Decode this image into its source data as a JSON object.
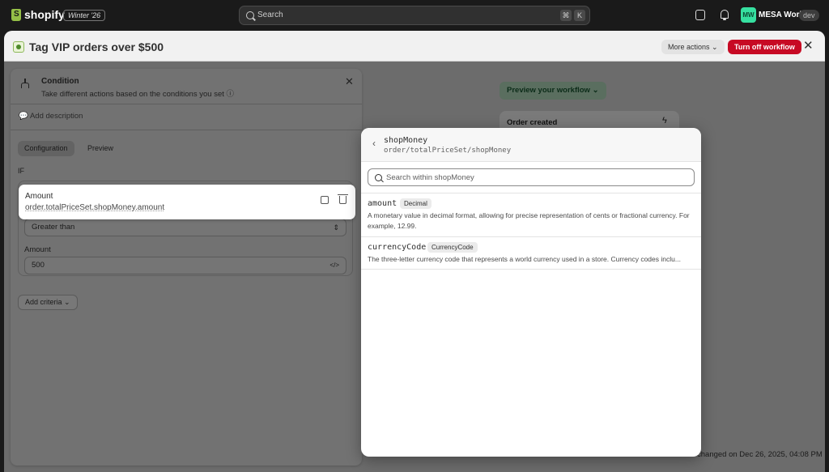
{
  "topbar": {
    "logo_text": "shopify",
    "edition": "Winter '26",
    "search_placeholder": "Search",
    "kbd_cmd": "⌘",
    "kbd_k": "K",
    "avatar_initials": "MW",
    "store_name": "MESA World",
    "env_badge": "dev"
  },
  "window": {
    "title": "Tag VIP orders over $500",
    "more_actions": "More actions",
    "turn_off": "Turn off workflow",
    "close": "✕"
  },
  "condition": {
    "title": "Condition",
    "subtitle": "Take different actions based on the conditions you set ⓘ",
    "add_description": "Add description",
    "tabs": [
      "Configuration",
      "Preview"
    ],
    "if_label": "IF",
    "operator": "Greater than",
    "amount_label": "Amount",
    "amount_value": "500",
    "add_criteria": "Add criteria ⌄"
  },
  "amount_card": {
    "label": "Amount",
    "path": "order.totalPriceSet.shopMoney.amount"
  },
  "canvas": {
    "preview_button": "Preview your workflow ⌄",
    "trigger_title": "Order created",
    "changed_text": "changed on Dec 26, 2025, 04:08 PM"
  },
  "popover": {
    "title": "shopMoney",
    "path": "order/totalPriceSet/shopMoney",
    "search_placeholder": "Search within shopMoney",
    "fields": [
      {
        "name": "amount",
        "type": "Decimal",
        "description": "A monetary value in decimal format, allowing for precise representation of cents or fractional currency. For example, 12.99."
      },
      {
        "name": "currencyCode",
        "type": "CurrencyCode",
        "description": "The three-letter currency code that represents a world currency used in a store. Currency codes inclu..."
      }
    ]
  }
}
